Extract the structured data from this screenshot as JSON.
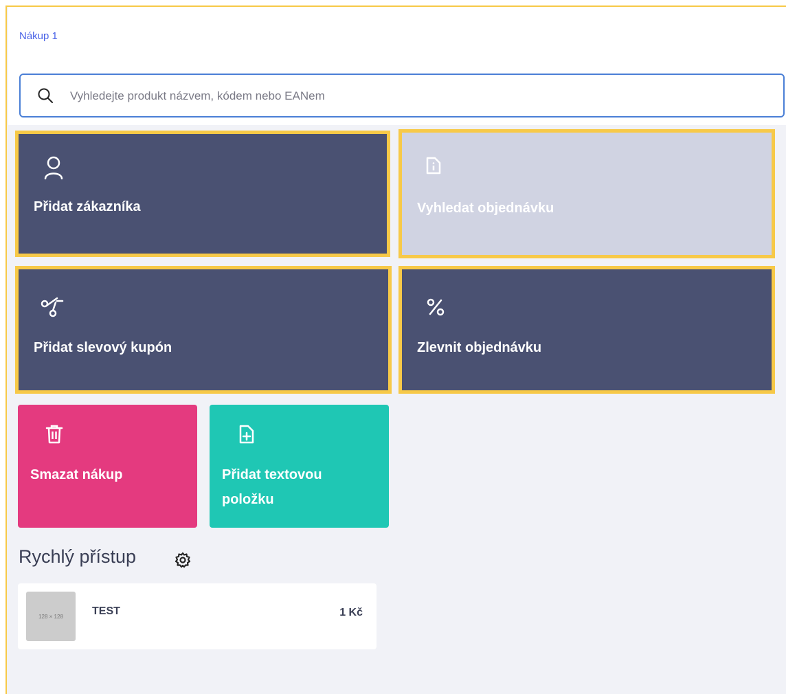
{
  "header": {
    "breadcrumb": "Nákup 1"
  },
  "search": {
    "placeholder": "Vyhledejte produkt názvem, kódem nebo EANem",
    "icon": "search-icon"
  },
  "actions": [
    {
      "label": "Přidat zákazníka",
      "icon": "user-icon",
      "color": "#4a5172"
    },
    {
      "label": "Vyhledat objednávku",
      "icon": "document-info-icon",
      "color": "#d0d3e2"
    },
    {
      "label": "Přidat slevový kupón",
      "icon": "scissors-icon",
      "color": "#4a5172"
    },
    {
      "label": "Zlevnit objednávku",
      "icon": "percent-icon",
      "color": "#4a5172"
    },
    {
      "label": "Smazat nákup",
      "icon": "trash-icon",
      "color": "#e43a7f"
    },
    {
      "label": "Přidat textovou položku",
      "icon": "document-add-icon",
      "color": "#1fc7b4"
    }
  ],
  "quick_access": {
    "title": "Rychlý přístup",
    "settings_icon": "gear-icon",
    "items": [
      {
        "name": "TEST",
        "price": "1 Kč",
        "thumb_text": "128 × 128"
      }
    ]
  },
  "colors": {
    "accent_outline": "#f7c948",
    "link": "#4a63e7"
  }
}
